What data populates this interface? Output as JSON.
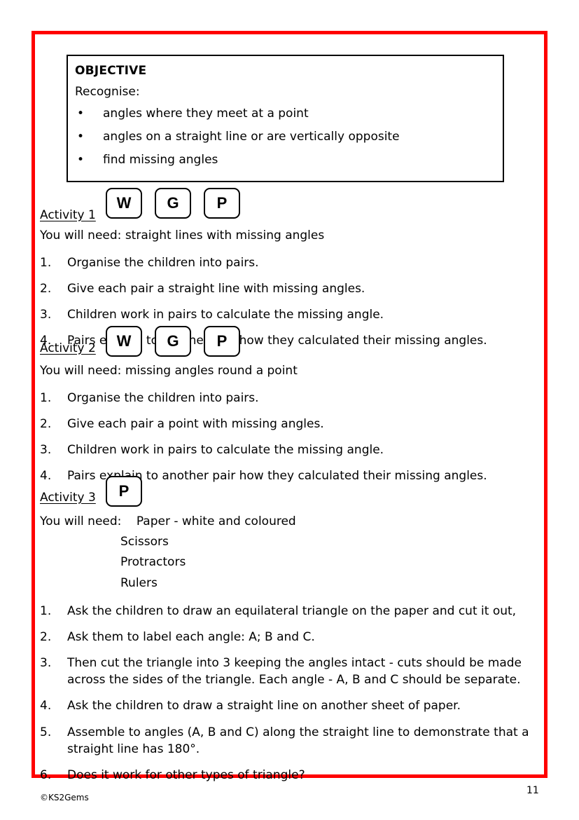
{
  "page": {
    "border_color": "#FF0000",
    "page_number": "11",
    "copyright": "©KS2Gems"
  },
  "objective": {
    "title": "OBJECTIVE",
    "subtitle": "Recognise:",
    "bullet": "•",
    "items": [
      "angles where they meet at a point",
      "angles on a straight line or are vertically opposite",
      "find missing angles"
    ]
  },
  "activities": [
    {
      "label": "Activity 1",
      "badges": [
        "W",
        "G",
        "P"
      ],
      "need_label": "You will need:",
      "need_value": "straight lines with missing angles",
      "steps": [
        {
          "num": "1.",
          "text": "Organise the children into pairs."
        },
        {
          "num": "2.",
          "text": "Give each pair a straight line with missing angles."
        },
        {
          "num": "3.",
          "text": "Children work in pairs to calculate the missing angle."
        },
        {
          "num": "4.",
          "text": "Pairs explain to another pair how they calculated their missing angles."
        }
      ]
    },
    {
      "label": "Activity 2",
      "badges": [
        "W",
        "G",
        "P"
      ],
      "need_label": "You will need:",
      "need_value": "missing angles round a point",
      "steps": [
        {
          "num": "1.",
          "text": "Organise the children into pairs."
        },
        {
          "num": "2.",
          "text": "Give each pair a point with missing angles."
        },
        {
          "num": "3.",
          "text": "Children work in pairs to calculate the missing angle."
        },
        {
          "num": "4.",
          "text": "Pairs explain to another pair how they calculated their missing angles."
        }
      ]
    },
    {
      "label": "Activity 3",
      "badges": [
        "P"
      ],
      "need_label": "You will need:",
      "materials": [
        "Paper - white and coloured",
        "Scissors",
        "Protractors",
        "Rulers"
      ],
      "steps": [
        {
          "num": "1.",
          "text": "Ask the children to draw an equilateral triangle on the paper and cut it out,"
        },
        {
          "num": "2.",
          "text": "Ask them to label each angle: A; B and C."
        },
        {
          "num": "3.",
          "text": "Then cut the triangle into 3 keeping the angles intact - cuts should be made across the sides of the triangle. Each angle - A, B and C should be separate."
        },
        {
          "num": "4.",
          "text": "Ask the children to draw a straight line on another sheet of paper."
        },
        {
          "num": "5.",
          "text": "Assemble to angles (A, B and C) along the straight line to demonstrate that a straight line has 180°."
        },
        {
          "num": "6.",
          "text": "Does it work for other types of triangle?"
        }
      ]
    }
  ]
}
